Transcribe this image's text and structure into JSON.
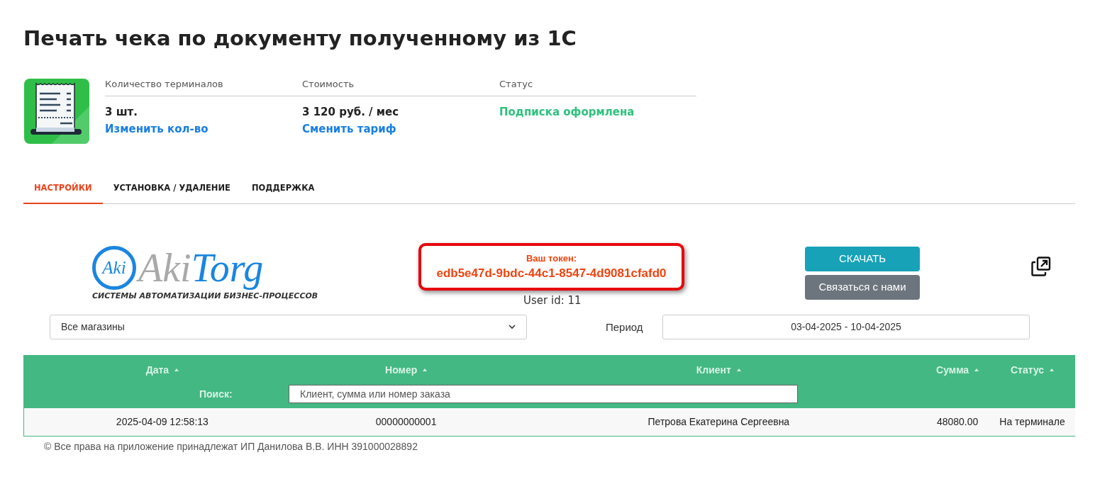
{
  "page_title": "Печать чека по документу полученному из 1С",
  "summary": [
    {
      "label": "Количество терминалов",
      "value": "3 шт.",
      "link": "Изменить кол-во"
    },
    {
      "label": "Стоимость",
      "value": "3 120 руб. / мес",
      "link": "Сменить тариф"
    },
    {
      "label": "Статус",
      "status": "Подписка оформлена"
    }
  ],
  "tabs": [
    {
      "label": "НАСТРОЙКИ",
      "selected": true
    },
    {
      "label": "УСТАНОВКА / УДАЛЕНИЕ",
      "selected": false
    },
    {
      "label": "ПОДДЕРЖКА",
      "selected": false
    }
  ],
  "logo": {
    "mark": "Aki",
    "name_part_1": "Aki",
    "name_part_2": "Torg",
    "tagline": "СИСТЕМЫ АВТОМАТИЗАЦИИ БИЗНЕС-ПРОЦЕССОВ"
  },
  "token": {
    "label": "Ваш токен:",
    "value": "edb5e47d-9bdc-44c1-8547-4d9081cfafd0",
    "user_id_label": "User id:",
    "user_id": "11"
  },
  "buttons": [
    {
      "kind": "primary",
      "label": "СКАЧАТЬ"
    },
    {
      "kind": "secondary",
      "label": "Связаться с нами"
    }
  ],
  "filters": {
    "store": "Все магазины",
    "period_label": "Период",
    "period": "03-04-2025 - 10-04-2025"
  },
  "table": {
    "columns": [
      "Дата",
      "Номер",
      "Клиент",
      "Сумма",
      "Статус"
    ],
    "search_label": "Поиск:",
    "search_placeholder": "Клиент, сумма или номер заказа",
    "rows": [
      [
        "2025-04-09 12:58:13",
        "00000000001",
        "Петрова Екатерина Сергеевна",
        "48080.00",
        "На терминале"
      ]
    ]
  },
  "footer": "© Все права на приложение принадлежат ИП Данилова В.В. ИНН 391000028892"
}
